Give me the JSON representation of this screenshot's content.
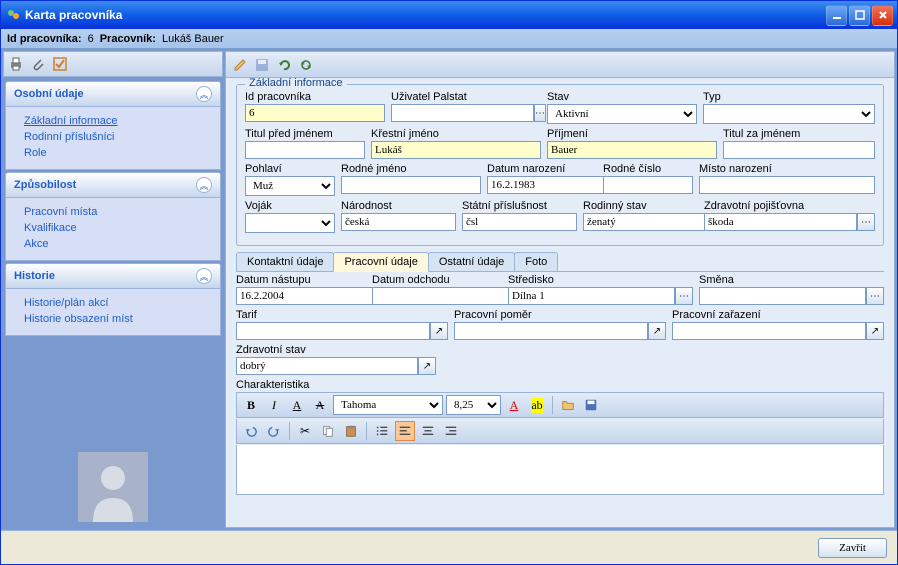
{
  "window": {
    "title": "Karta pracovníka"
  },
  "infobar": {
    "id_label": "Id pracovníka:",
    "id_value": "6",
    "worker_label": "Pracovník:",
    "worker_value": "Lukáš Bauer"
  },
  "sidebar": {
    "groups": [
      {
        "title": "Osobní údaje",
        "items": [
          "Základní informace",
          "Rodinní příslušníci",
          "Role"
        ]
      },
      {
        "title": "Způsobilost",
        "items": [
          "Pracovní místa",
          "Kvalifikace",
          "Akce"
        ]
      },
      {
        "title": "Historie",
        "items": [
          "Historie/plán akcí",
          "Historie obsazení míst"
        ]
      }
    ]
  },
  "basicInfo": {
    "legend": "Základní informace",
    "fields": {
      "id_label": "Id pracovníka",
      "id_value": "6",
      "user_label": "Uživatel Palstat",
      "user_value": "",
      "state_label": "Stav",
      "state_value": "Aktivní",
      "type_label": "Typ",
      "type_value": "",
      "title_before_label": "Titul před jménem",
      "title_before_value": "",
      "first_name_label": "Křestní jméno",
      "first_name_value": "Lukáš",
      "surname_label": "Příjmení",
      "surname_value": "Bauer",
      "title_after_label": "Titul za jménem",
      "title_after_value": "",
      "gender_label": "Pohlaví",
      "gender_value": "Muž",
      "maiden_label": "Rodné jméno",
      "maiden_value": "",
      "birth_date_label": "Datum narození",
      "birth_date_value": "16.2.1983",
      "birth_num_label": "Rodné číslo",
      "birth_num_value": "",
      "birth_place_label": "Místo narození",
      "birth_place_value": "",
      "soldier_label": "Voják",
      "soldier_value": "",
      "nationality_label": "Národnost",
      "nationality_value": "česká",
      "citizenship_label": "Státní příslušnost",
      "citizenship_value": "čsl",
      "family_label": "Rodinný stav",
      "family_value": "ženatý",
      "insurance_label": "Zdravotní pojišťovna",
      "insurance_value": "škoda"
    }
  },
  "tabs": {
    "items": [
      "Kontaktní údaje",
      "Pracovní údaje",
      "Ostatní údaje",
      "Foto"
    ],
    "active": "Pracovní údaje"
  },
  "workTab": {
    "start_label": "Datum nástupu",
    "start_value": "16.2.2004",
    "end_label": "Datum odchodu",
    "end_value": "",
    "center_label": "Středisko",
    "center_value": "Dílna 1",
    "shift_label": "Směna",
    "shift_value": "",
    "tariff_label": "Tarif",
    "tariff_value": "",
    "relation_label": "Pracovní poměr",
    "relation_value": "",
    "assignment_label": "Pracovní zařazení",
    "assignment_value": "",
    "health_label": "Zdravotní stav",
    "health_value": "dobrý",
    "char_label": "Charakteristika"
  },
  "rte": {
    "font": "Tahoma",
    "size": "8,25"
  },
  "footer": {
    "close": "Zavřít"
  }
}
